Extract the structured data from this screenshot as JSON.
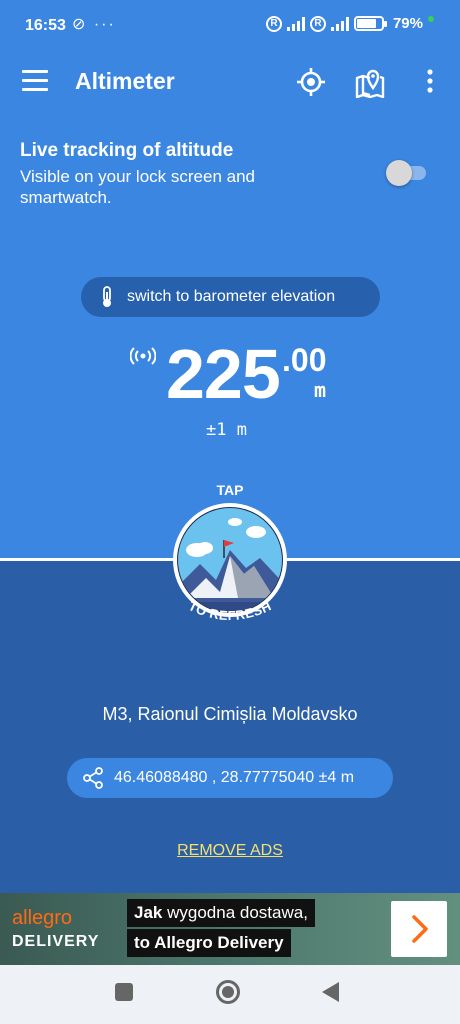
{
  "status_bar": {
    "time": "16:53",
    "left_icons": "⊘ ···",
    "roaming": "R",
    "battery_percent": "79%",
    "battery_level": 0.79
  },
  "app_bar": {
    "title": "Altimeter",
    "icons": [
      "menu-icon",
      "gps-target-icon",
      "map-pin-icon",
      "more-vert-icon"
    ]
  },
  "live_tracking": {
    "title": "Live tracking of altitude",
    "description": "Visible on your lock screen and smartwatch.",
    "enabled": false
  },
  "barometer_button": {
    "label": "switch to barometer elevation"
  },
  "altitude": {
    "value": "225",
    "decimals": ".00",
    "unit": "m",
    "accuracy": "±1 m"
  },
  "refresh": {
    "tap": "TAP",
    "to_refresh": "TO REFRESH"
  },
  "location": {
    "name": "M3, Raionul Cimișlia Moldavsko",
    "coordinates": "46.46088480 , 28.77775040 ±4 m"
  },
  "remove_ads": "REMOVE ADS",
  "ad": {
    "brand_top": "allegro",
    "brand_bottom": "DELIVERY",
    "line1_bold": "Jak",
    "line1_rest": " wygodna dostawa,",
    "line2": "to Allegro Delivery"
  },
  "colors": {
    "top_background": "#3b86e0",
    "bottom_background": "#2a5fa8",
    "button_dark": "#2760ad",
    "remove_ads": "#f5e06c"
  }
}
